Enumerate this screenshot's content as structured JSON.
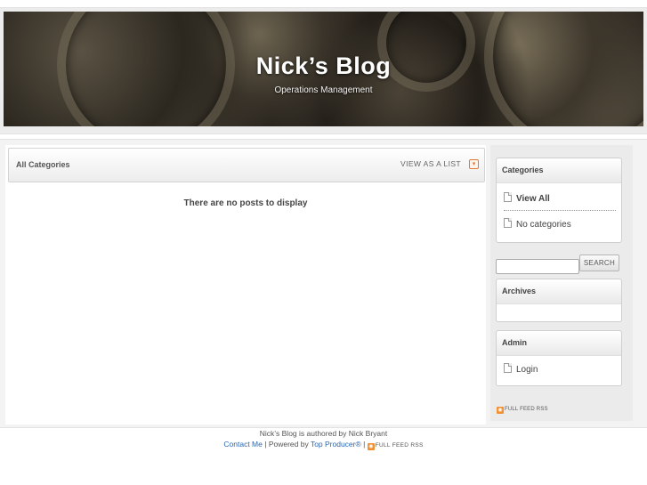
{
  "header": {
    "title": "Nick’s Blog",
    "subtitle": "Operations Management"
  },
  "content": {
    "category_label": "All Categories",
    "view_as_list": "VIEW AS A LIST",
    "empty_message": "There are no posts to display"
  },
  "sidebar": {
    "categories": {
      "title": "Categories",
      "view_all": "View All",
      "no_categories": "No categories"
    },
    "search": {
      "button": "SEARCH",
      "value": ""
    },
    "archives": {
      "title": "Archives"
    },
    "admin": {
      "title": "Admin",
      "login": "Login"
    },
    "rss": "FULL FEED RSS"
  },
  "footer": {
    "authored": "Nick’s Blog is authored by Nick Bryant",
    "contact": "Contact Me",
    "sep1": "|",
    "powered": "Powered by",
    "producer": "Top Producer®",
    "sep2": "|",
    "rss": "FULL FEED RSS"
  },
  "colors": {
    "link": "#2a68b4",
    "rss": "#f09030",
    "dropdown_accent": "#e07a3a"
  },
  "icons": [
    "chevron-down-icon",
    "document-icon",
    "rss-icon"
  ]
}
